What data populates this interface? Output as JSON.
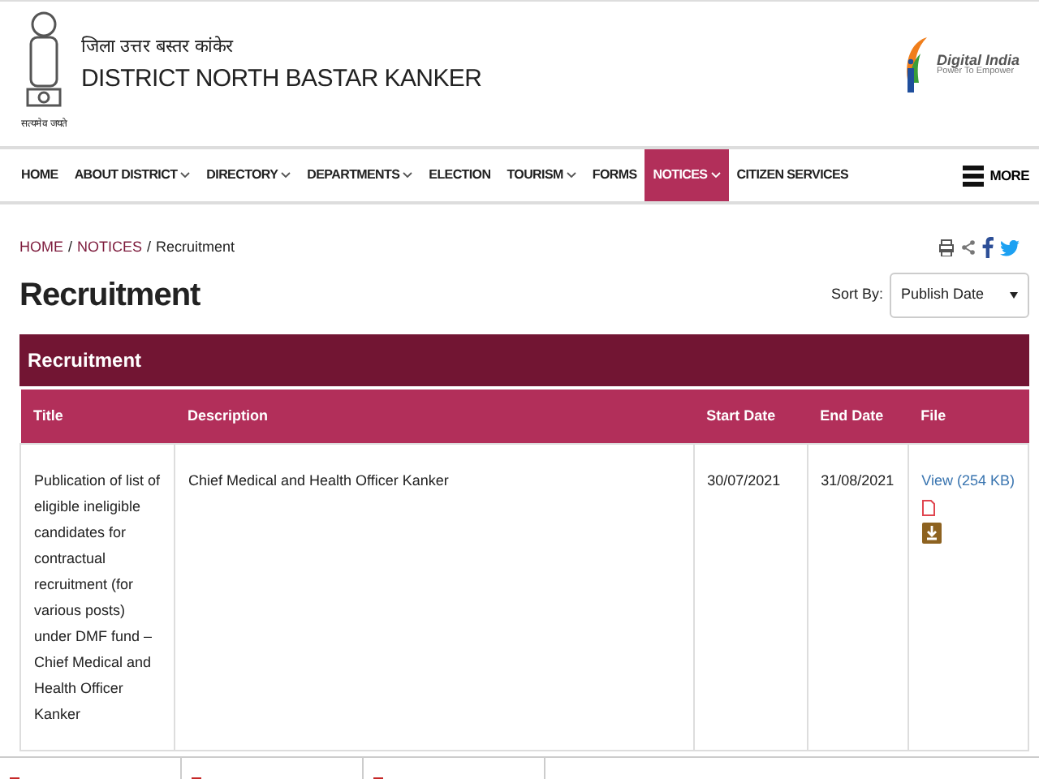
{
  "header": {
    "hindi_title": "जिला उत्तर बस्तर कांकेर",
    "title": "DISTRICT NORTH BASTAR KANKER",
    "emblem_motto": "सत्यमेव जयते",
    "digital_india": {
      "name": "Digital India",
      "tagline": "Power To Empower"
    }
  },
  "nav": {
    "items": [
      {
        "label": "HOME",
        "dropdown": false,
        "selected": false
      },
      {
        "label": "ABOUT DISTRICT",
        "dropdown": true,
        "selected": false
      },
      {
        "label": "DIRECTORY",
        "dropdown": true,
        "selected": false
      },
      {
        "label": "DEPARTMENTS",
        "dropdown": true,
        "selected": false
      },
      {
        "label": "ELECTION",
        "dropdown": false,
        "selected": false
      },
      {
        "label": "TOURISM",
        "dropdown": true,
        "selected": false
      },
      {
        "label": "FORMS",
        "dropdown": false,
        "selected": false
      },
      {
        "label": "NOTICES",
        "dropdown": true,
        "selected": true
      },
      {
        "label": "CITIZEN SERVICES",
        "dropdown": false,
        "selected": false
      }
    ],
    "more": "MORE"
  },
  "breadcrumb": [
    {
      "label": "HOME",
      "link": true,
      "separator": "/"
    },
    {
      "label": "NOTICES",
      "link": true,
      "separator": "/"
    },
    {
      "label": "Recruitment",
      "link": false
    }
  ],
  "page_title": "Recruitment",
  "sort": {
    "label": "Sort By:",
    "value": "Publish Date"
  },
  "table": {
    "caption": "Recruitment",
    "columns": [
      "Title",
      "Description",
      "Start Date",
      "End Date",
      "File"
    ],
    "rows": [
      {
        "title": "Publication of list of eligible ineligible candidates for contractual recruitment (for various posts) under DMF fund – Chief Medical and Health Officer Kanker",
        "description": "Chief Medical and Health Officer Kanker",
        "start_date": "30/07/2021",
        "end_date": "31/08/2021",
        "file": "View (254 KB)"
      }
    ]
  }
}
